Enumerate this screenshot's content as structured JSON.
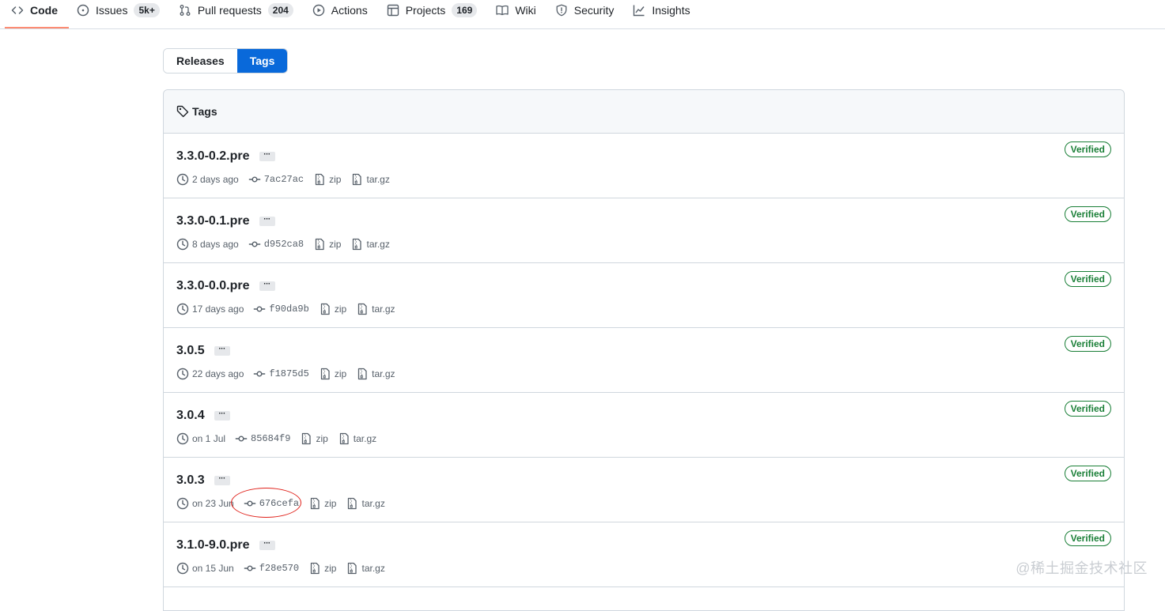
{
  "repo_nav": {
    "code": "Code",
    "issues": "Issues",
    "issues_count": "5k+",
    "pull_requests": "Pull requests",
    "pull_requests_count": "204",
    "actions": "Actions",
    "projects": "Projects",
    "projects_count": "169",
    "wiki": "Wiki",
    "security": "Security",
    "insights": "Insights"
  },
  "segmented": {
    "releases": "Releases",
    "tags": "Tags",
    "active": "Tags"
  },
  "box": {
    "title": "Tags"
  },
  "tags": [
    {
      "name": "3.3.0-0.2.pre",
      "date": "2 days ago",
      "sha": "7ac27ac",
      "zip": "zip",
      "targz": "tar.gz",
      "badge": "Verified"
    },
    {
      "name": "3.3.0-0.1.pre",
      "date": "8 days ago",
      "sha": "d952ca8",
      "zip": "zip",
      "targz": "tar.gz",
      "badge": "Verified"
    },
    {
      "name": "3.3.0-0.0.pre",
      "date": "17 days ago",
      "sha": "f90da9b",
      "zip": "zip",
      "targz": "tar.gz",
      "badge": "Verified"
    },
    {
      "name": "3.0.5",
      "date": "22 days ago",
      "sha": "f1875d5",
      "zip": "zip",
      "targz": "tar.gz",
      "badge": "Verified"
    },
    {
      "name": "3.0.4",
      "date": "on 1 Jul",
      "sha": "85684f9",
      "zip": "zip",
      "targz": "tar.gz",
      "badge": "Verified"
    },
    {
      "name": "3.0.3",
      "date": "on 23 Jun",
      "sha": "676cefa",
      "zip": "zip",
      "targz": "tar.gz",
      "badge": "Verified"
    },
    {
      "name": "3.1.0-9.0.pre",
      "date": "on 15 Jun",
      "sha": "f28e570",
      "zip": "zip",
      "targz": "tar.gz",
      "badge": "Verified"
    }
  ],
  "colors": {
    "accent": "#0969da",
    "verified": "#1a7f37",
    "selected_underline": "#fd8c73",
    "highlight_circle": "#e0221b"
  },
  "watermark": "@稀土掘金技术社区"
}
